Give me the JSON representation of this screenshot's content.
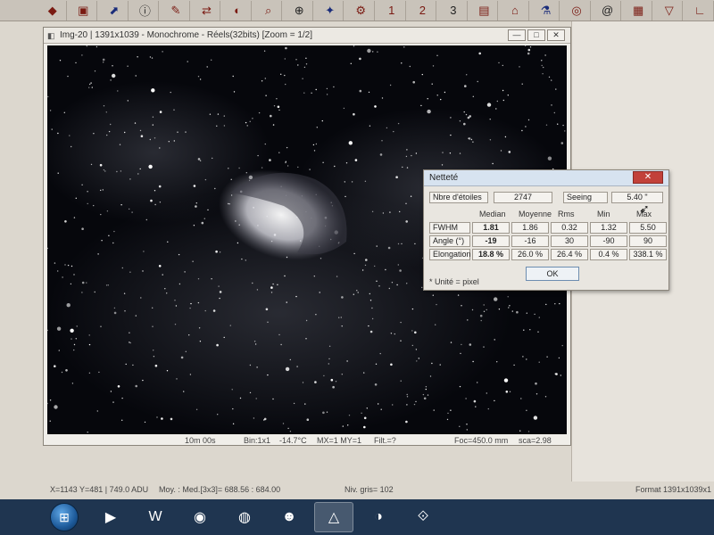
{
  "toolbar": {
    "icons": [
      {
        "name": "app-logo-icon",
        "glyph": "◆"
      },
      {
        "name": "save-icon",
        "glyph": "▣"
      },
      {
        "name": "export-icon",
        "glyph": "⬈"
      },
      {
        "name": "info-icon",
        "glyph": "ⓘ"
      },
      {
        "name": "pencil-icon",
        "glyph": "✎"
      },
      {
        "name": "arrows-icon",
        "glyph": "⇄"
      },
      {
        "name": "palette-icon",
        "glyph": "◐"
      },
      {
        "name": "zoom-icon",
        "glyph": "⌕"
      },
      {
        "name": "zoom-in-icon",
        "glyph": "⊕"
      },
      {
        "name": "star-icon",
        "glyph": "✦"
      },
      {
        "name": "wheel-icon",
        "glyph": "⚙"
      },
      {
        "name": "step-1-icon",
        "glyph": "1"
      },
      {
        "name": "step-2-icon",
        "glyph": "2"
      },
      {
        "name": "step-3-icon",
        "glyph": "3"
      },
      {
        "name": "stack-icon",
        "glyph": "▤"
      },
      {
        "name": "home-icon",
        "glyph": "⌂"
      },
      {
        "name": "flask-icon",
        "glyph": "⚗"
      },
      {
        "name": "disk-icon",
        "glyph": "◎"
      },
      {
        "name": "spiral-icon",
        "glyph": "@"
      },
      {
        "name": "grid-icon",
        "glyph": "▦"
      },
      {
        "name": "bucket-icon",
        "glyph": "▽"
      },
      {
        "name": "curve-icon",
        "glyph": "∟"
      }
    ]
  },
  "image_window": {
    "title": "Img-20 | 1391x1039 - Monochrome - Réels(32bits) [Zoom = 1/2]",
    "minimize": "—",
    "maximize": "□",
    "close": "✕",
    "status": {
      "exposure": "10m 00s",
      "binning": "Bin:1x1",
      "temperature": "-14.7°C",
      "mx_my": "MX=1 MY=1",
      "filter": "Filt.=?",
      "focal": "Foc=450.0 mm",
      "scale": "sca=2.98"
    }
  },
  "dialog": {
    "title": "Netteté",
    "close": "✕",
    "stars_label": "Nbre d'étoiles",
    "stars_value": "2747",
    "seeing_label": "Seeing",
    "seeing_value": "5.40 \"",
    "columns": [
      "Median",
      "Moyenne",
      "Rms",
      "Min",
      "Max"
    ],
    "rows": [
      {
        "label": "FWHM",
        "values": [
          "1.81",
          "1.86",
          "0.32",
          "1.32",
          "5.50"
        ]
      },
      {
        "label": "Angle (°)",
        "values": [
          "-19",
          "-16",
          "30",
          "-90",
          "90"
        ]
      },
      {
        "label": "Elongation",
        "values": [
          "18.8 %",
          "26.0 %",
          "26.4 %",
          "0.4 %",
          "338.1 %"
        ]
      }
    ],
    "unit_note": "* Unité = pixel",
    "ok_label": "OK"
  },
  "bottom_status": {
    "coords": "X=1143 Y=481 | 749.0 ADU",
    "moyenne": "Moy. : Med.[3x3]= 688.56 : 684.00",
    "niv_gris": "Niv. gris= 102",
    "format": "Format 1391x1039x1"
  },
  "taskbar": {
    "items": [
      {
        "name": "start-orb-icon",
        "glyph": "⊞"
      },
      {
        "name": "media-player-icon",
        "glyph": "▶"
      },
      {
        "name": "word-icon",
        "glyph": "W"
      },
      {
        "name": "phd-icon",
        "glyph": "◉"
      },
      {
        "name": "chrome-icon",
        "glyph": "◍"
      },
      {
        "name": "astronaut-icon",
        "glyph": "☻"
      },
      {
        "name": "prism-icon",
        "glyph": "△"
      },
      {
        "name": "globe-icon",
        "glyph": "◑"
      },
      {
        "name": "apt-icon",
        "glyph": "⟐"
      }
    ]
  }
}
